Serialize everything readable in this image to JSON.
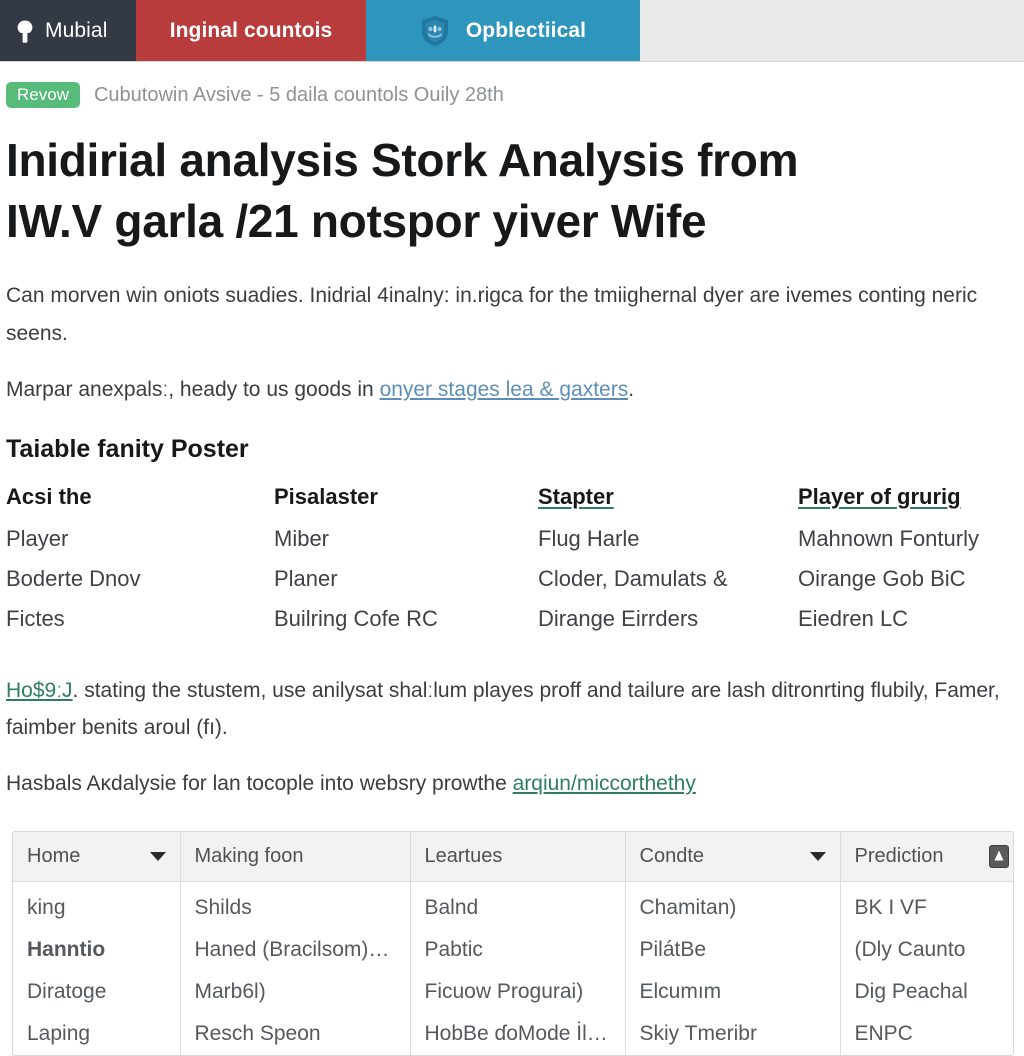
{
  "topbar": {
    "segments": [
      {
        "label": "Mubial",
        "icon": "person-icon",
        "color": "#333a45"
      },
      {
        "label": "Inginal countois",
        "icon": "",
        "color": "#b83c3c"
      },
      {
        "label": "Opblectiical",
        "icon": "shield-icon",
        "color": "#2e95bd"
      }
    ]
  },
  "meta": {
    "badge": "Revow",
    "text": "Cubutowin Avsive - 5 daila countols Ouily 28th"
  },
  "headline": "Inidirial analysis Stork Analysis from IW.V garla /21 notspor yiver Wife",
  "paragraph1": "Can morven win oniots suadies. Inidrial 4inalny: in.rigca for the tmiighernal dyer are ivemes conting neric seens.",
  "paragraph2": {
    "pre": "Marpar anexpalsː, heady to us goods in ",
    "link": "onyer stages lea & gaxters",
    "post": "."
  },
  "subhead": "Taiable fanity Poster",
  "columns": [
    {
      "header": "Acsi the",
      "underline": false,
      "cells": [
        "Player",
        "Boderte Dnov",
        "Fictes"
      ]
    },
    {
      "header": "Pisalaster",
      "underline": false,
      "cells": [
        "Miber",
        "Planer",
        "Builring Cofe RC"
      ]
    },
    {
      "header": "Stapter",
      "underline": true,
      "cells": [
        "Flug Harle",
        "Cloder, Damulats &",
        "Dirange Eirrders"
      ]
    },
    {
      "header": "Player of grurig",
      "underline": true,
      "cells": [
        "Mahnown Fonturly",
        "Oirange Gob BiC",
        "Eiedren LC"
      ]
    }
  ],
  "paragraph3": {
    "link": "Ho$9ːJ",
    "text": ". stating the stustem, use anilysat shalːlum playes proff and tailure are lash ditronrting flubily, Famer, faimber benits aroul (fı)."
  },
  "paragraph4": {
    "pre": "Hasbals Aκdalysie for lan tocople into websry prowthe ",
    "link": "arqiun/miccorthethy"
  },
  "table": {
    "headers": [
      {
        "label": "Home",
        "icon": "chevron-down-icon"
      },
      {
        "label": "Making foon",
        "icon": ""
      },
      {
        "label": "Leartues",
        "icon": ""
      },
      {
        "label": "Condte",
        "icon": "chevron-down-icon"
      },
      {
        "label": "Prediction",
        "icon": "prediction-icon"
      }
    ],
    "rows": [
      [
        "king",
        "Shilds",
        "Balnd",
        "Chamitan)",
        "BK I VF"
      ],
      [
        "Hanntio",
        "Haned (Bracilsom)…",
        "Pabtic",
        "PilátBe",
        "(Dly Caunto"
      ],
      [
        "Diratoge",
        "Marb6l)",
        "Ficuow Progurai)",
        "Elcumım",
        "Dig Peachal"
      ],
      [
        "Laping",
        "Resch Speon",
        "HobBe ɗoMode İl…",
        "Skiy Tmeribr",
        "ENPC"
      ]
    ]
  },
  "colors": {
    "brand_dark": "#333a45",
    "brand_red": "#b83c3c",
    "brand_blue": "#2e95bd",
    "badge_green": "#57bb79",
    "link_blue": "#4a7fa7",
    "link_teal": "#2e7d64"
  }
}
